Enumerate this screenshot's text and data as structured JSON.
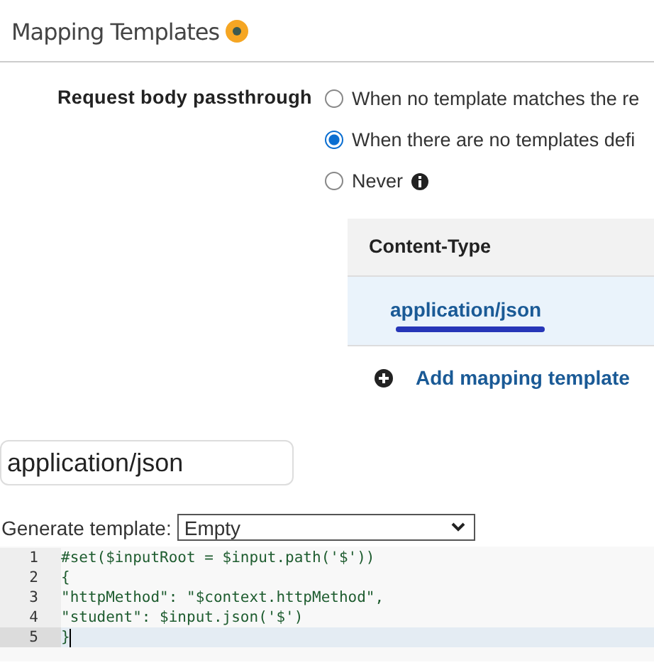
{
  "section": {
    "title": "Mapping Templates"
  },
  "passthrough": {
    "label": "Request body passthrough",
    "options": [
      {
        "text": "When no template matches the re",
        "selected": false,
        "info": false
      },
      {
        "text": "When there are no templates defi",
        "selected": true,
        "info": false
      },
      {
        "text": "Never",
        "selected": false,
        "info": true
      }
    ]
  },
  "table": {
    "columns": [
      "Content-Type"
    ],
    "rows": [
      {
        "cells": [
          "application/json"
        ],
        "selected": true,
        "underlined": true
      }
    ]
  },
  "add_button": "Add mapping template",
  "content_type_field": {
    "value": "application/json"
  },
  "generate": {
    "label": "Generate template:",
    "value": "Empty"
  },
  "editor": {
    "lines": [
      {
        "number": "1",
        "text": "#set($inputRoot = $input.path('$'))",
        "active": false
      },
      {
        "number": "2",
        "text": "{",
        "active": false
      },
      {
        "number": "3",
        "text": "\"httpMethod\": \"$context.httpMethod\",",
        "active": false
      },
      {
        "number": "4",
        "text": "\"student\": $input.json('$')",
        "active": false
      },
      {
        "number": "5",
        "text": "}",
        "active": true
      }
    ]
  }
}
